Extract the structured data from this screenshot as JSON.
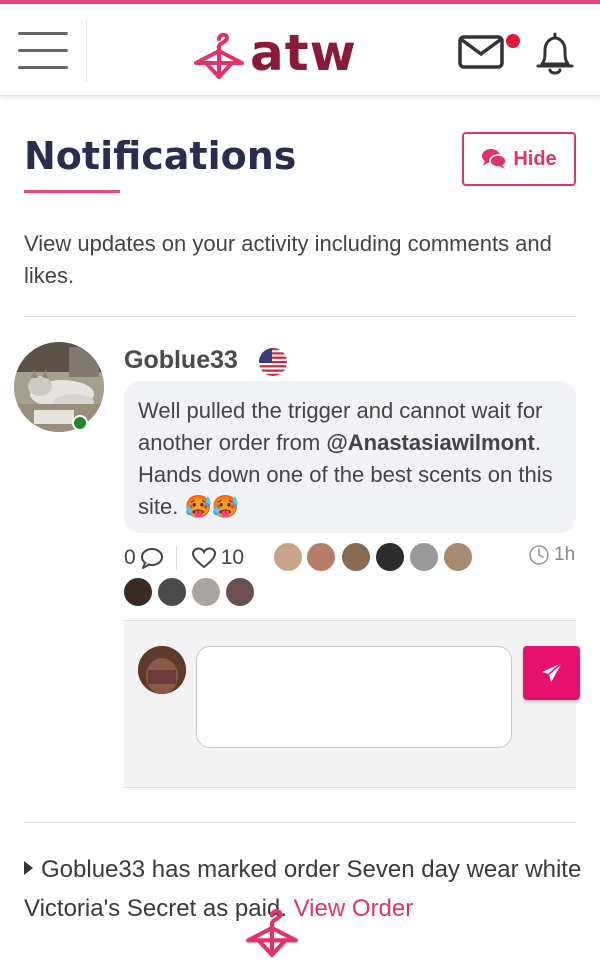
{
  "header": {
    "logo_text": "atw",
    "mail_has_unread": true
  },
  "page": {
    "title": "Notifications",
    "hide_button_label": "Hide",
    "intro": "View updates on your activity including comments and likes."
  },
  "notification": {
    "username": "Goblue33",
    "online": true,
    "message_part1": "Well pulled the trigger and cannot wait for another order from ",
    "mention": "@Anastasiawilmont",
    "message_part2": ". Hands down one of the best scents on this site. ",
    "emoji": "🥵🥵",
    "comment_count": "0",
    "like_count": "10",
    "time_ago": "1h"
  },
  "reply": {
    "placeholder": ""
  },
  "event": {
    "text": "Goblue33 has marked order Seven day wear white Victoria's Secret as paid. ",
    "link_label": "View Order"
  },
  "colors": {
    "accent": "#e0336d",
    "brand": "#8a1a3a",
    "title": "#2a2d4e",
    "send": "#e8106f"
  }
}
